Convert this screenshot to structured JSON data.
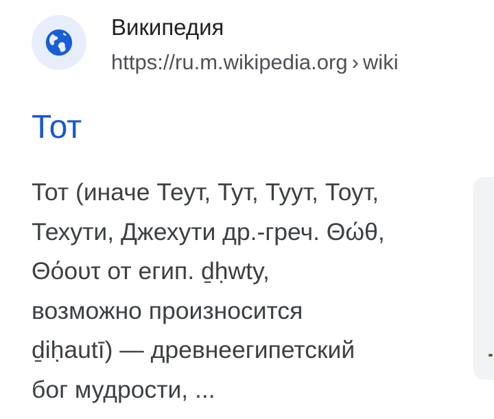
{
  "source": {
    "site_name": "Википедия",
    "url": "https://ru.m.wikipedia.org",
    "separator": "›",
    "path": "wiki",
    "icon": "globe-icon"
  },
  "result": {
    "title": "Тот",
    "snippet_lines": [
      "Тот (иначе Теут, Тут, Туут, Тоут,",
      "Техути, Джехути др.-греч. Θώθ,",
      "Θόουτ от егип. ḏḥwty,",
      "возможно произносится",
      "ḏiḥautī) — древнеегипетский",
      "бог мудрости, ..."
    ]
  },
  "colors": {
    "title_link": "#1558d6",
    "icon_fill": "#1a5ed6",
    "icon_bg": "#e8eefb"
  }
}
